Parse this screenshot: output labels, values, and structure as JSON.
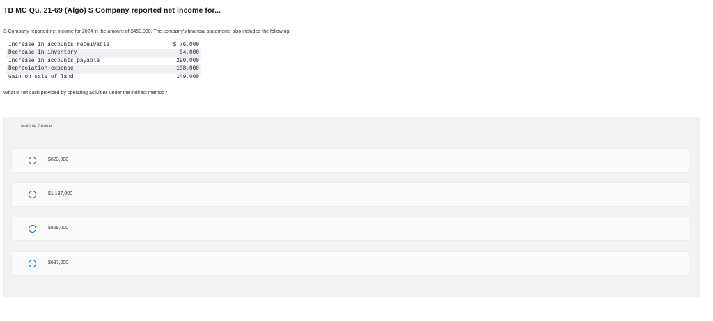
{
  "title": "TB MC Qu. 21-69 (Algo) S Company reported net income for...",
  "question": {
    "intro": "S Company reported net income for 2024 in the amount of $450,000. The company's financial statements also included the following:",
    "rows": [
      {
        "label": "Increase in accounts receivable",
        "amount": "$ 76,000"
      },
      {
        "label": "Decrease in inventory",
        "amount": "64,000"
      },
      {
        "label": "Increase in accounts payable",
        "amount": "290,000"
      },
      {
        "label": "Depreciation expense",
        "amount": "108,000"
      },
      {
        "label": "Gain on sale of land",
        "amount": "149,000"
      }
    ],
    "prompt": "What is net cash provided by operating activities under the indirect method?"
  },
  "multiple_choice": {
    "label": "Multiple Choice",
    "options": [
      "$623,000",
      "$1,137,000",
      "$829,000",
      "$687,000"
    ]
  },
  "colors": {
    "radio_border": "#1a73d9",
    "panel_bg": "#f2f2f2",
    "row_stripe": "#eceff5"
  }
}
